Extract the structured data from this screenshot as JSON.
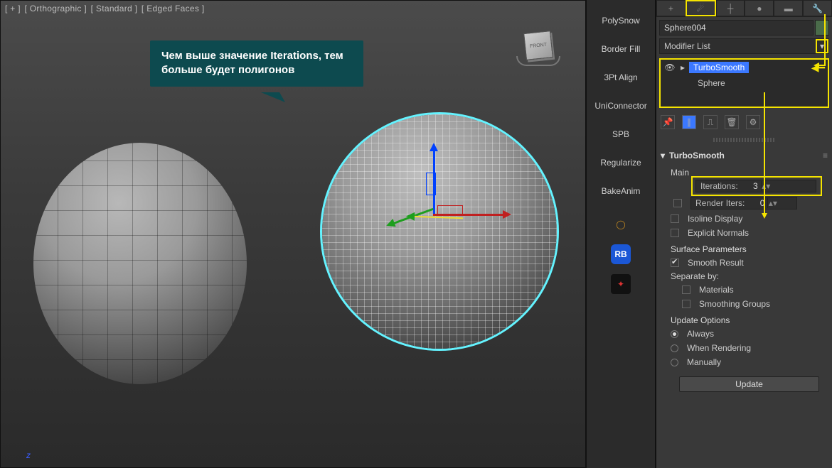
{
  "viewport": {
    "labels": [
      "[ + ]",
      "[ Orthographic ]",
      "[ Standard ]",
      "[ Edged Faces ]"
    ],
    "axis_label": "z",
    "viewcube_face": "FRONT"
  },
  "callout": {
    "text": "Чем выше значение Iterations, тем больше будет полигонов"
  },
  "scripts_panel": {
    "items": [
      "PolySnow",
      "Border Fill",
      "3Pt Align",
      "UniConnector",
      "SPB",
      "Regularize",
      "BakeAnim"
    ],
    "tool_rb": "RB"
  },
  "command_panel": {
    "object_name": "Sphere004",
    "modifier_list_label": "Modifier List",
    "stack": {
      "item_selected": "TurboSmooth",
      "item_base": "Sphere"
    },
    "rollout": {
      "title": "TurboSmooth",
      "main_label": "Main",
      "iterations": {
        "label": "Iterations:",
        "value": "3"
      },
      "render_iters": {
        "label": "Render Iters:",
        "value": "0"
      },
      "isoline_label": "Isoline Display",
      "explicit_label": "Explicit Normals",
      "surface_params_label": "Surface Parameters",
      "smooth_result_label": "Smooth Result",
      "separate_label": "Separate by:",
      "materials_label": "Materials",
      "smoothing_groups_label": "Smoothing Groups",
      "update_options_label": "Update Options",
      "opt_always": "Always",
      "opt_render": "When Rendering",
      "opt_manual": "Manually",
      "update_btn": "Update"
    }
  }
}
